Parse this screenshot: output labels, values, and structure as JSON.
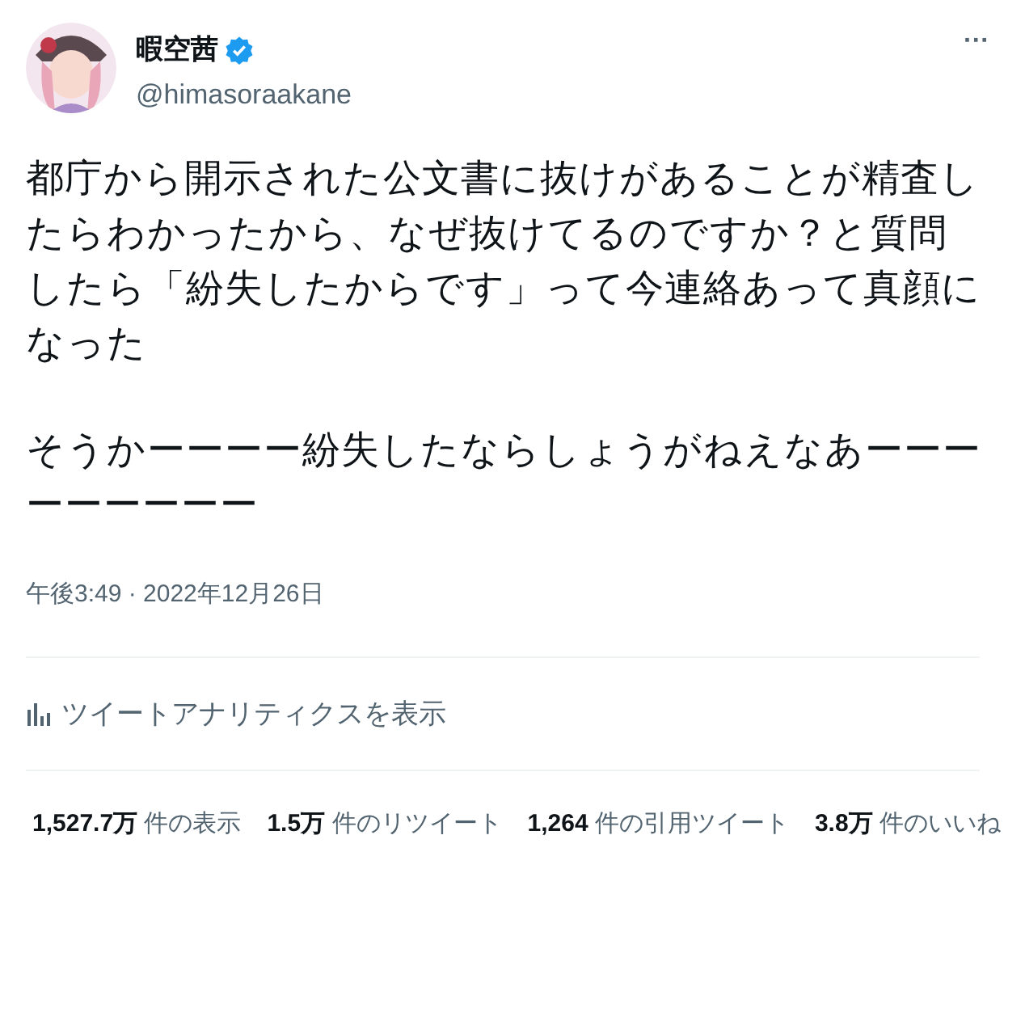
{
  "author": {
    "name": "暇空茜",
    "verified": true,
    "handle": "@himasoraakane"
  },
  "more": "···",
  "body": [
    "都庁から開示された公文書に抜けがあることが精査したらわかったから、なぜ抜けてるのですか？と質問したら「紛失したからです」って今連絡あって真顔になった",
    "そうかーーーー紛失したならしょうがねえなあーーーーーーーーー"
  ],
  "timestamp": "午後3:49 · 2022年12月26日",
  "analytics": "ツイートアナリティクスを表示",
  "stats": [
    {
      "count": "1,527.7万",
      "label": "件の表示"
    },
    {
      "count": "1.5万",
      "label": "件のリツイート"
    },
    {
      "count": "1,264",
      "label": "件の引用ツイート"
    },
    {
      "count": "3.8万",
      "label": "件のいいね"
    }
  ]
}
